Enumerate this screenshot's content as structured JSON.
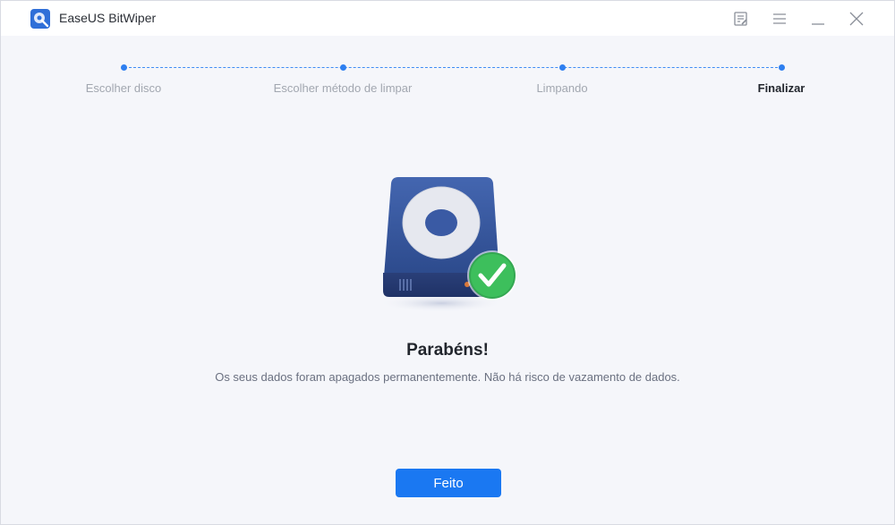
{
  "app": {
    "title": "EaseUS BitWiper"
  },
  "titlebar": {
    "buttons": [
      {
        "name": "feedback-icon"
      },
      {
        "name": "menu-icon"
      },
      {
        "name": "minimize-icon"
      },
      {
        "name": "close-icon"
      }
    ]
  },
  "steps": [
    {
      "label": "Escolher disco",
      "state": "done"
    },
    {
      "label": "Escolher método de limpar",
      "state": "done"
    },
    {
      "label": "Limpando",
      "state": "done"
    },
    {
      "label": "Finalizar",
      "state": "current"
    }
  ],
  "result": {
    "icon": "hard-drive-check-icon",
    "title": "Parabéns!",
    "message": "Os seus dados foram apagados permanentemente. Não há risco de vazamento de dados."
  },
  "done_button": {
    "label": "Feito"
  },
  "colors": {
    "accent": "#1a78f2",
    "success": "#3dbf5c",
    "drive": "#34549a",
    "background": "#f5f6fa"
  }
}
